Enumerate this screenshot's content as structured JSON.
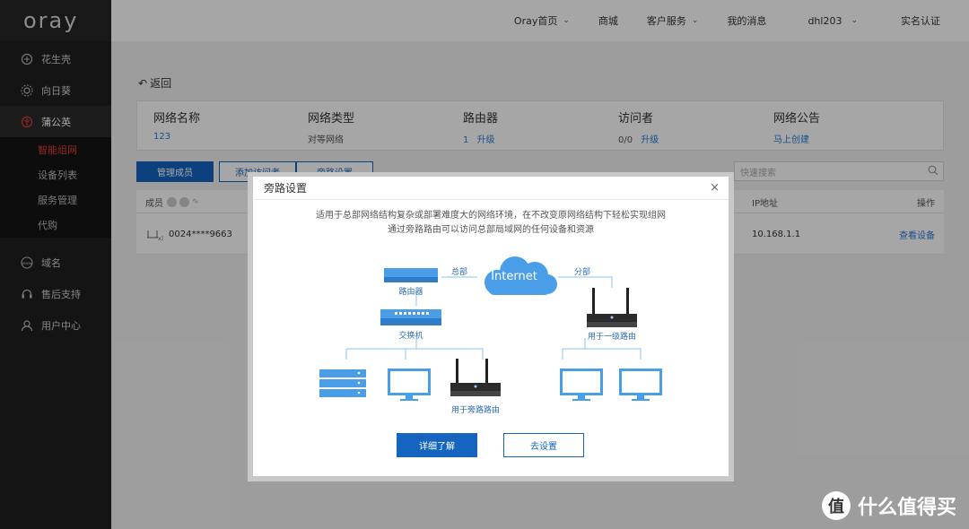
{
  "app": {
    "logo": "oray"
  },
  "sidebar": {
    "items": [
      {
        "label": "花生壳",
        "icon": "peanut-icon"
      },
      {
        "label": "向日葵",
        "icon": "sunflower-icon"
      },
      {
        "label": "蒲公英",
        "icon": "dandelion-icon"
      }
    ],
    "sub_items": [
      {
        "label": "智能组网",
        "active": true
      },
      {
        "label": "设备列表"
      },
      {
        "label": "服务管理"
      },
      {
        "label": "代购"
      }
    ],
    "bottom_items": [
      {
        "label": "域名",
        "icon": "www-icon"
      },
      {
        "label": "售后支持",
        "icon": "headset-icon"
      },
      {
        "label": "用户中心",
        "icon": "user-icon"
      }
    ]
  },
  "topbar": {
    "home": "Oray首页",
    "mall": "商城",
    "service": "客户服务",
    "messages": "我的消息",
    "user": "dhl203",
    "verify": "实名认证"
  },
  "main": {
    "back": "返回",
    "info": {
      "network_name_h": "网络名称",
      "network_name_v": "123",
      "network_type_h": "网络类型",
      "network_type_v": "对等网络",
      "router_h": "路由器",
      "router_count": "1",
      "router_upgrade": "升级",
      "visitor_h": "访问者",
      "visitor_count": "0/0",
      "visitor_upgrade": "升级",
      "notice_h": "网络公告",
      "notice_v": "马上创建"
    },
    "buttons": {
      "manage": "管理成员",
      "add_visitor": "添加访问者",
      "bypass": "旁路设置"
    },
    "search_placeholder": "快速搜索",
    "table": {
      "col_member": "成员",
      "col_ip": "IP地址",
      "col_op": "操作",
      "rows": [
        {
          "device": "0024****9663",
          "ip": "10.168.1.1",
          "op": "查看设备"
        }
      ]
    }
  },
  "modal": {
    "title": "旁路设置",
    "desc_line1": "适用于总部网络结构复杂或部署难度大的网络环境，在不改变原网络结构下轻松实现组网",
    "desc_line2": "通过旁路路由可以访问总部局域网的任何设备和资源",
    "diagram": {
      "internet": "Internet",
      "hq": "总部",
      "branch": "分部",
      "router": "路由器",
      "switch": "交换机",
      "level1_router": "用于一级路由",
      "bypass_router": "用于旁路路由"
    },
    "btn_detail": "详细了解",
    "btn_setup": "去设置"
  },
  "watermark": {
    "logo_char": "值",
    "text": "什么值得买"
  },
  "colors": {
    "accent": "#1565c0",
    "sidebar_bg": "#1f1f1f",
    "active_red": "#e53935",
    "diagram_blue": "#3b8fe0"
  }
}
